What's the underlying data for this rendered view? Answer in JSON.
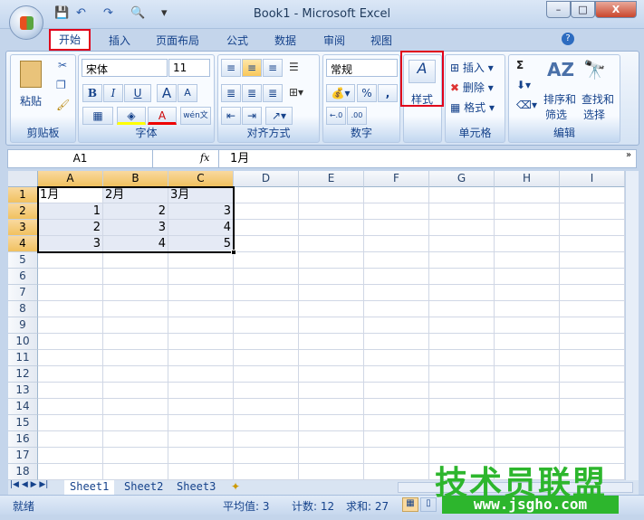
{
  "window": {
    "title": "Book1 - Microsoft Excel",
    "minimize": "–",
    "restore": "□",
    "close": "X"
  },
  "qat": {
    "save": "💾",
    "undo": "↶",
    "redo": "↷",
    "preview": "🔍",
    "more": "▾"
  },
  "tabs": [
    {
      "label": "开始",
      "active": true
    },
    {
      "label": "插入"
    },
    {
      "label": "页面布局"
    },
    {
      "label": "公式"
    },
    {
      "label": "数据"
    },
    {
      "label": "审阅"
    },
    {
      "label": "视图"
    }
  ],
  "ribbon": {
    "clipboard": {
      "label": "剪贴板",
      "paste": "粘贴"
    },
    "font": {
      "label": "字体",
      "name": "宋体",
      "size": "11",
      "bold": "B",
      "italic": "I",
      "underline": "U",
      "grow": "A",
      "shrink": "A",
      "wen": "wén文"
    },
    "alignment": {
      "label": "对齐方式"
    },
    "number": {
      "label": "数字",
      "format": "常规",
      "percent": "%",
      "comma": ",",
      "inc": "←.0",
      "dec": ".00"
    },
    "styles": {
      "label": "样式"
    },
    "cells": {
      "label": "单元格",
      "insert": "插入",
      "delete": "删除",
      "format": "格式"
    },
    "editing": {
      "label": "编辑",
      "sort": "排序和",
      "sort2": "筛选",
      "find": "查找和",
      "find2": "选择",
      "sum": "Σ"
    }
  },
  "formula_bar": {
    "name_box": "A1",
    "fx": "fx",
    "value": "1月"
  },
  "columns": [
    "A",
    "B",
    "C",
    "D",
    "E",
    "F",
    "G",
    "H",
    "I"
  ],
  "rows": [
    "1",
    "2",
    "3",
    "4",
    "5",
    "6",
    "7",
    "8",
    "9",
    "10",
    "11",
    "12",
    "13",
    "14",
    "15",
    "16",
    "17",
    "18"
  ],
  "cells": [
    [
      "1月",
      "2月",
      "3月"
    ],
    [
      "1",
      "2",
      "3"
    ],
    [
      "2",
      "3",
      "4"
    ],
    [
      "3",
      "4",
      "5"
    ]
  ],
  "sheets": [
    "Sheet1",
    "Sheet2",
    "Sheet3"
  ],
  "status": {
    "ready": "就绪",
    "average": "平均值: 3",
    "count": "计数: 12",
    "sum": "求和: 27"
  },
  "watermark": {
    "text": "技术员联盟",
    "url": "www.jsgho.com"
  }
}
